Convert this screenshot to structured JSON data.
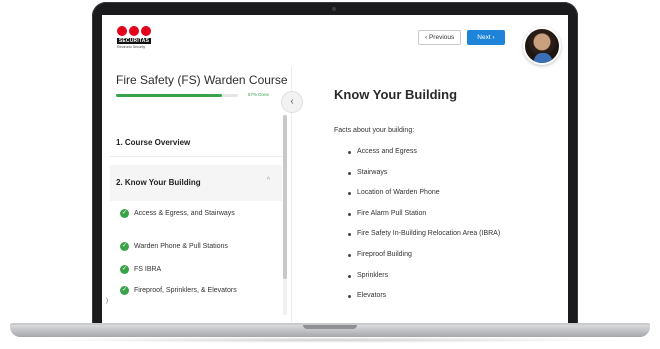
{
  "logo": {
    "brand": "SECURITAS",
    "subtitle": "Electronic Security"
  },
  "header": {
    "prev_label": "‹ Previous",
    "next_label": "Next ›"
  },
  "sidebar": {
    "course_title": "Fire Safety (FS) Warden Course",
    "progress_fraction": 0.87,
    "progress_text": "87% Done",
    "sections": [
      {
        "label": "1.  Course Overview"
      },
      {
        "label": "2.  Know Your Building",
        "chevron": "^"
      }
    ],
    "subitems": [
      {
        "label": "Access & Egress, and Stairways"
      },
      {
        "label": "Warden Phone & Pull Stations"
      },
      {
        "label": "FS IBRA"
      },
      {
        "label": "Fireproof, Sprinklers, & Elevators"
      }
    ],
    "side_mark": ")"
  },
  "main": {
    "title": "Know Your Building",
    "intro": "Facts about your building:",
    "bullets": [
      "Access and Egress",
      "Stairways",
      "Location of Warden Phone",
      "Fire Alarm Pull Station",
      "Fire Safety In-Building Relocation Area (IBRA)",
      "Fireproof Building",
      "Sprinklers",
      "Elevators"
    ]
  },
  "colors": {
    "accent_blue": "#1d84da",
    "progress_green": "#3aa34a",
    "brand_red": "#e2001a"
  },
  "icons": {
    "collapse": "chevron-left-icon",
    "complete": "check-circle-icon"
  }
}
